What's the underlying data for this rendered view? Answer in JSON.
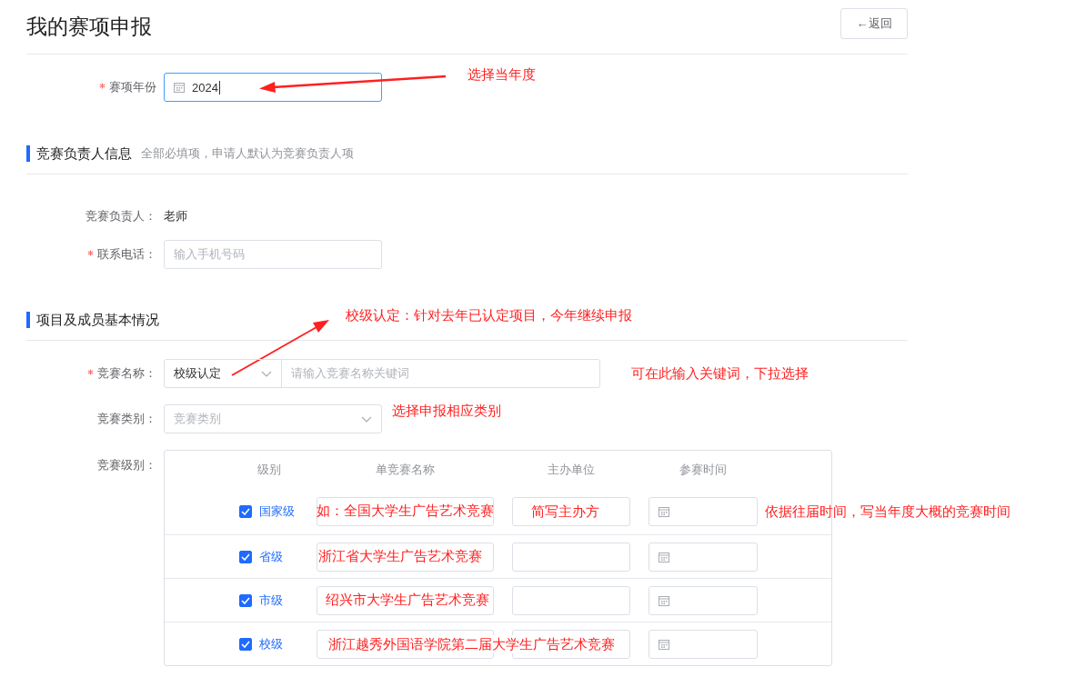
{
  "header": {
    "title": "我的赛项申报",
    "back_button": "←返回"
  },
  "year": {
    "label": "赛项年份",
    "required": true,
    "value": "2024",
    "focused": true,
    "annotation": "选择当年度"
  },
  "leader_section": {
    "title": "竞赛负责人信息",
    "hint": "全部必填项，申请人默认为竞赛负责人项"
  },
  "leader": {
    "label": "竞赛负责人：",
    "value": "老师"
  },
  "phone": {
    "label": "联系电话：",
    "required": true,
    "placeholder": "输入手机号码"
  },
  "project_section": {
    "title": "项目及成员基本情况",
    "annotation": "校级认定：针对去年已认定项目，今年继续申报"
  },
  "competition_name": {
    "label": "竞赛名称：",
    "required": true,
    "select_value": "校级认定",
    "placeholder": "请输入竞赛名称关键词",
    "annotation": "可在此输入关键词，下拉选择"
  },
  "category": {
    "label": "竞赛类别：",
    "required": false,
    "placeholder": "竞赛类别",
    "annotation": "选择申报相应类别"
  },
  "levels": {
    "label": "竞赛级别：",
    "columns": [
      "级别",
      "单竞赛名称",
      "主办单位",
      "参赛时间"
    ],
    "rows": [
      {
        "level": "国家级",
        "checked": true,
        "name_note": "如：全国大学生广告艺术竞赛",
        "organizer_note": "简写主办方",
        "time_note": "依据往届时间，写当年度大概的竞赛时间"
      },
      {
        "level": "省级",
        "checked": true,
        "name_note": "浙江省大学生广告艺术竞赛"
      },
      {
        "level": "市级",
        "checked": true,
        "name_note": "绍兴市大学生广告艺术竞赛"
      },
      {
        "level": "校级",
        "checked": true,
        "name_note": "浙江越秀外国语学院第二届大学生广告艺术竞赛"
      }
    ]
  }
}
